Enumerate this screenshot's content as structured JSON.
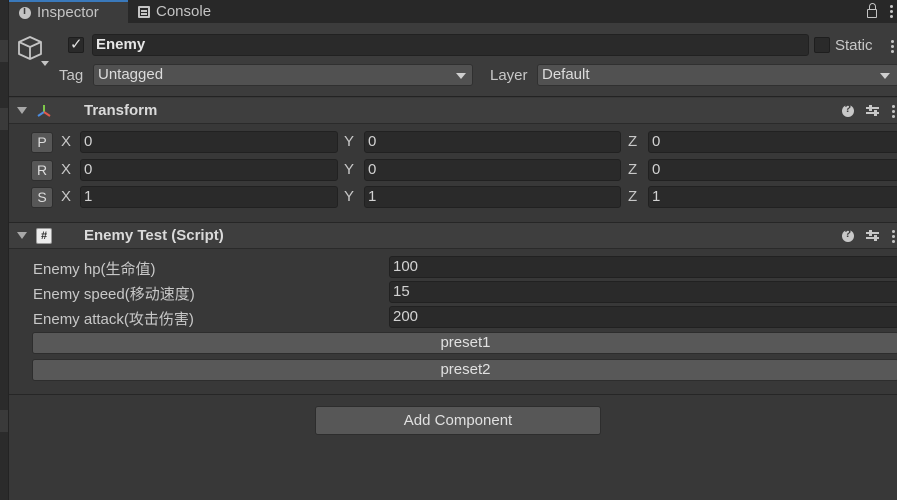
{
  "tabs": [
    {
      "label": "Inspector",
      "icon": "info-icon",
      "active": true
    },
    {
      "label": "Console",
      "icon": "console-icon",
      "active": false
    }
  ],
  "header": {
    "active": true,
    "name": "Enemy",
    "static_label": "Static",
    "static_checked": false,
    "tag_label": "Tag",
    "tag_value": "Untagged",
    "layer_label": "Layer",
    "layer_value": "Default"
  },
  "transform": {
    "title": "Transform",
    "rows": [
      {
        "button": "P",
        "x": "0",
        "y": "0",
        "z": "0"
      },
      {
        "button": "R",
        "x": "0",
        "y": "0",
        "z": "0"
      },
      {
        "button": "S",
        "x": "1",
        "y": "1",
        "z": "1"
      }
    ],
    "axis_labels": {
      "x": "X",
      "y": "Y",
      "z": "Z"
    }
  },
  "script": {
    "title": "Enemy Test (Script)",
    "icon": "#",
    "fields": [
      {
        "label": "Enemy hp(生命值)",
        "value": "100"
      },
      {
        "label": "Enemy speed(移动速度)",
        "value": "15"
      },
      {
        "label": "Enemy attack(攻击伤害)",
        "value": "200"
      }
    ],
    "buttons": [
      "preset1",
      "preset2"
    ]
  },
  "add_component_label": "Add Component",
  "colors": {
    "background": "#383838",
    "field": "#2a2a2a",
    "button": "#585858",
    "accent": "#3a79bb"
  }
}
